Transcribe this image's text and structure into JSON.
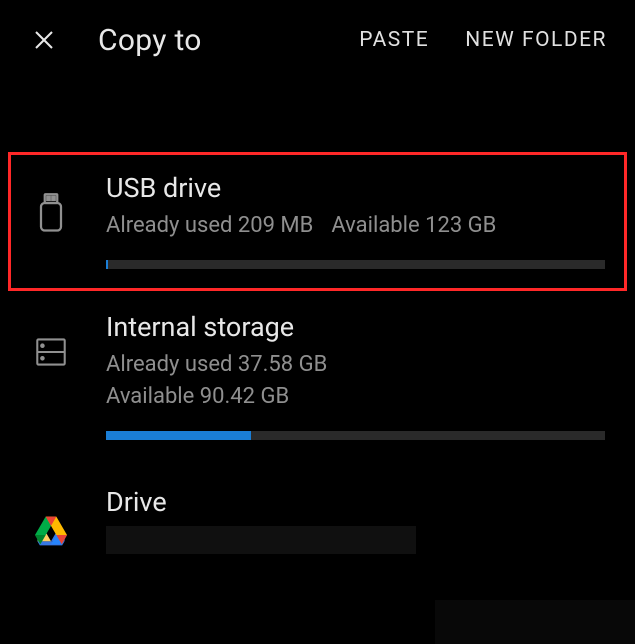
{
  "header": {
    "title": "Copy to",
    "actions": {
      "paste_label": "PASTE",
      "new_folder_label": "NEW FOLDER"
    }
  },
  "storage": {
    "usb": {
      "name": "USB drive",
      "used_label": "Already used 209 MB",
      "available_label": "Available 123 GB",
      "progress_percent": 0.5
    },
    "internal": {
      "name": "Internal storage",
      "used_label": "Already used 37.58 GB",
      "available_label": "Available 90.42 GB",
      "progress_percent": 29
    },
    "drive": {
      "name": "Drive"
    }
  }
}
